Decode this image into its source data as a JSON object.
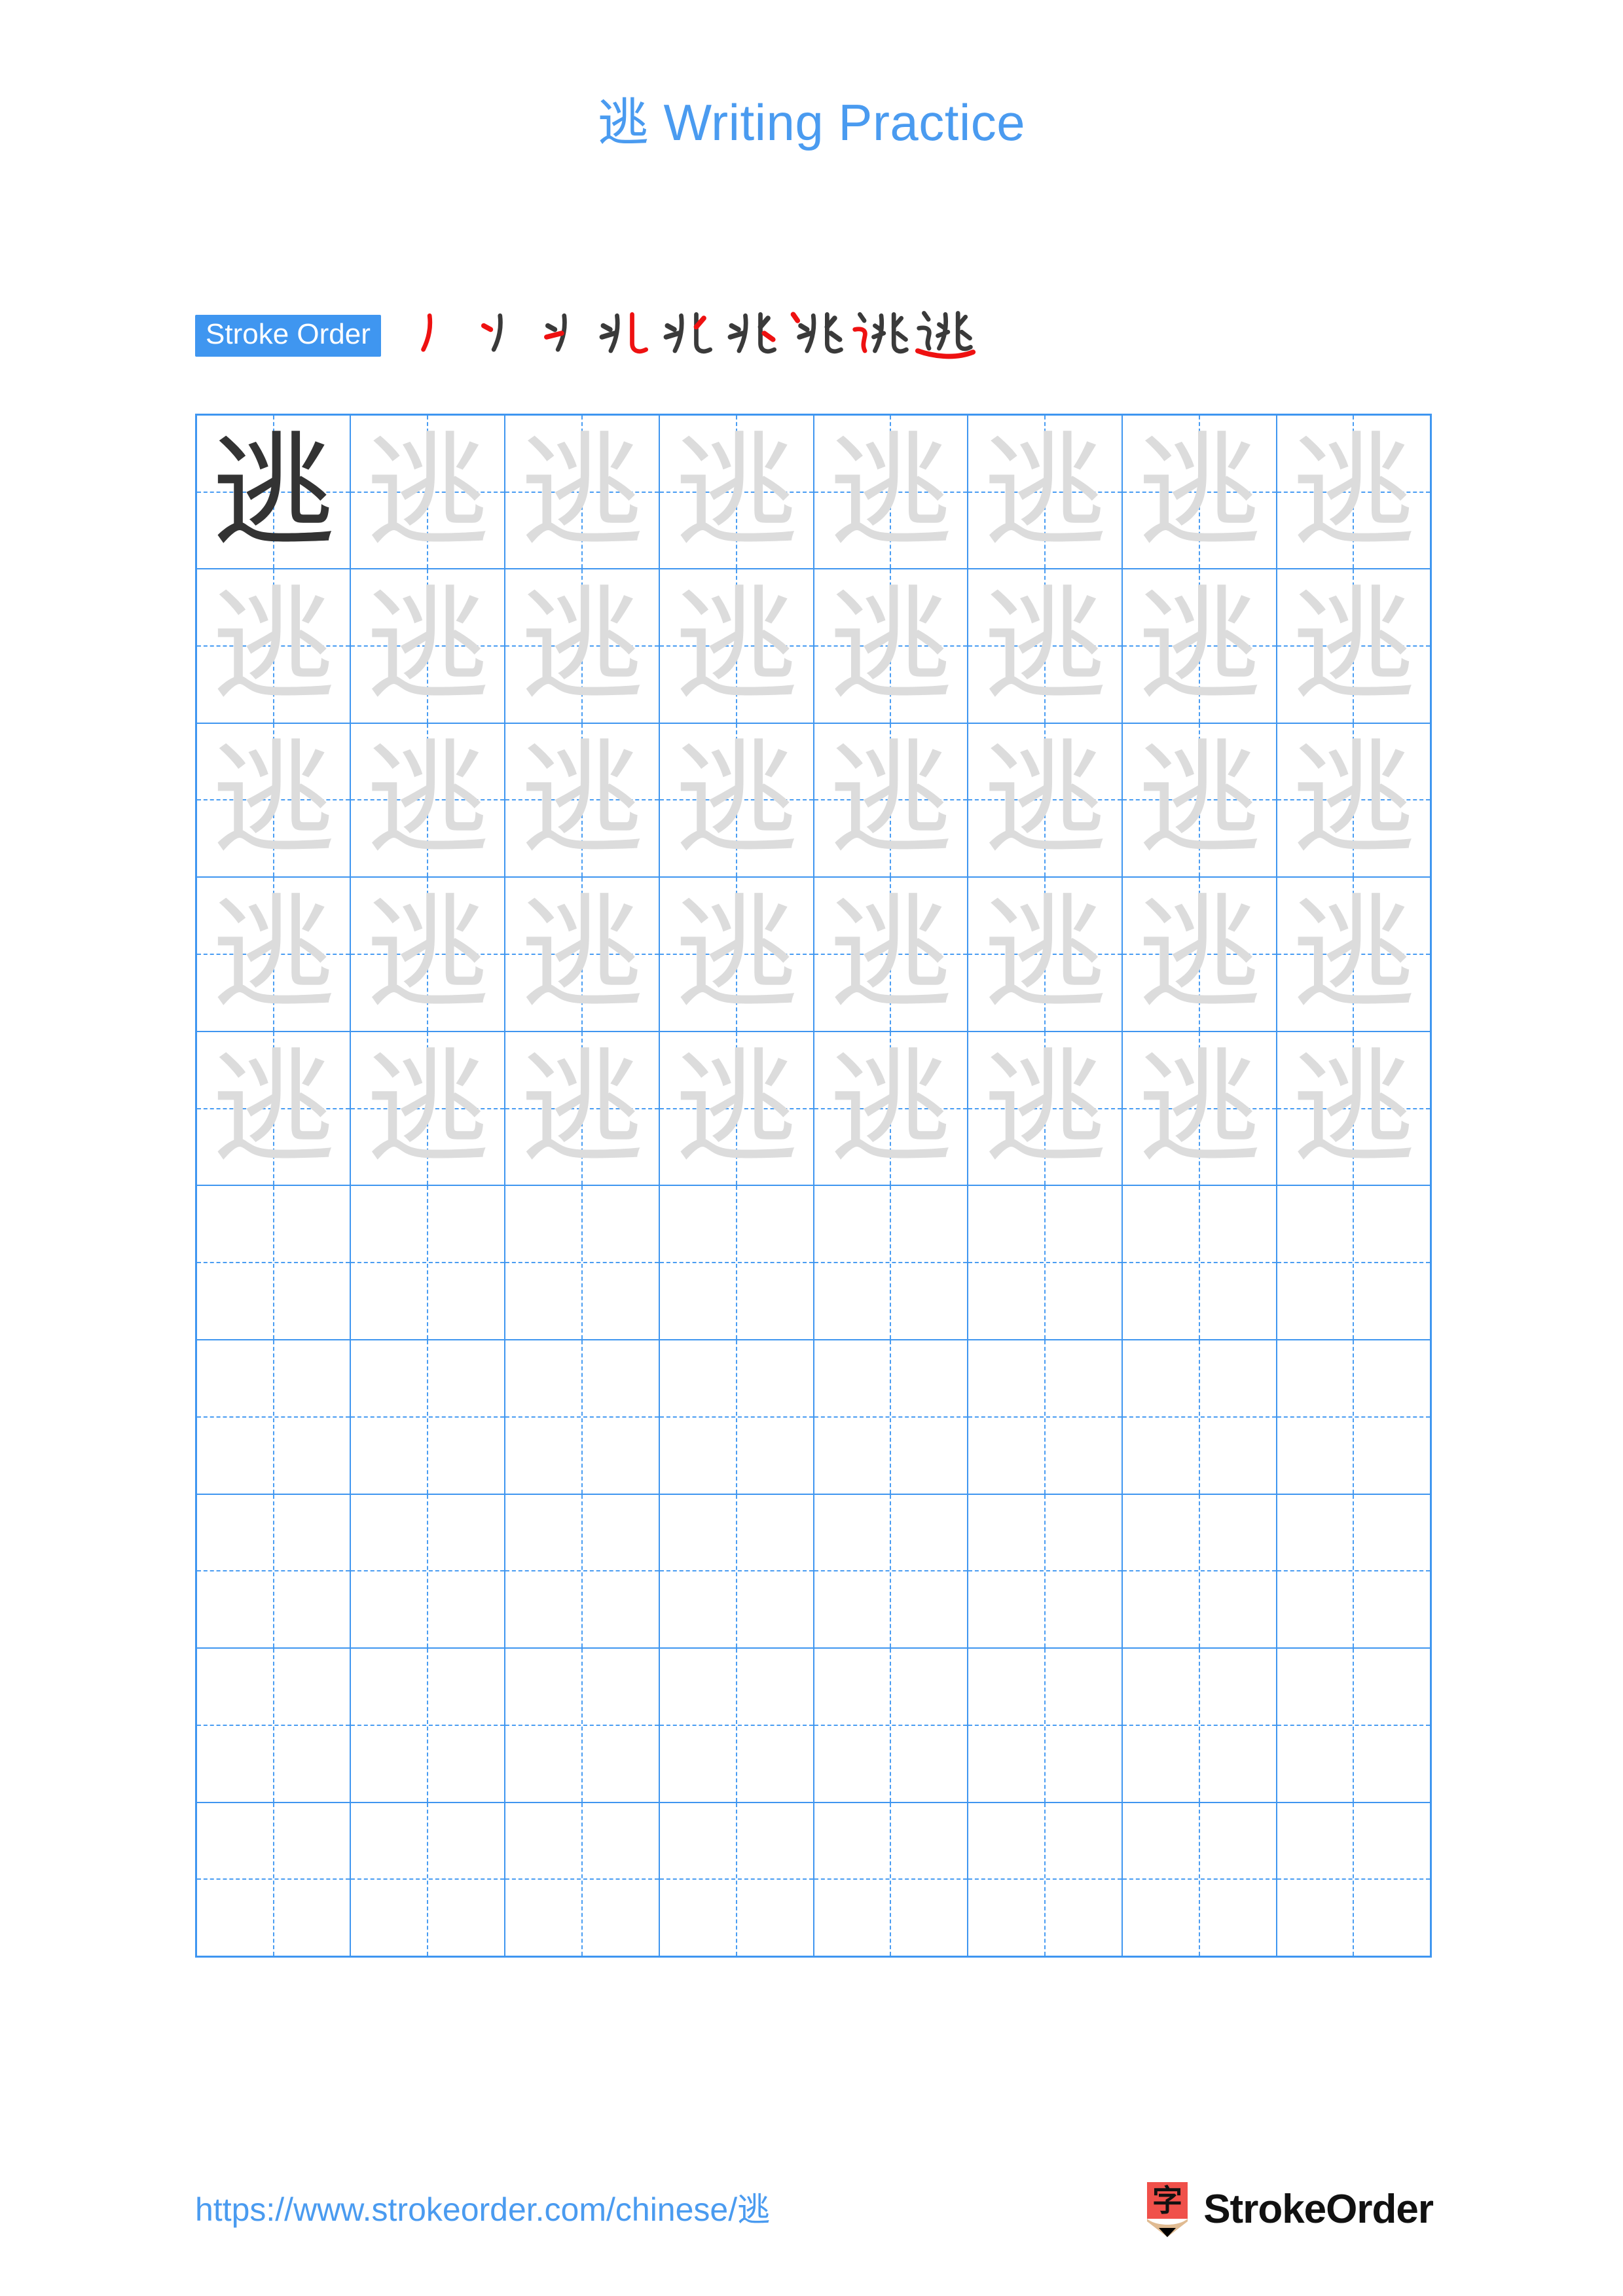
{
  "page": {
    "character": "逃",
    "title_suffix": " Writing Practice",
    "background_color": "#ffffff",
    "accent_color": "#4a9bf0"
  },
  "title": {
    "full": "逃 Writing Practice",
    "char": "逃",
    "label": "Writing Practice"
  },
  "stroke_order": {
    "badge_label": "Stroke Order",
    "badge_bg": "#3f96f0",
    "badge_text_color": "#ffffff",
    "new_stroke_color": "#ee1111",
    "old_stroke_color": "#3a3a3a",
    "total_strokes": 9,
    "steps": [
      {
        "index": 1,
        "glyph": "丿",
        "new_strokes": 1
      },
      {
        "index": 2,
        "glyph": "丿丶",
        "new_strokes": 1
      },
      {
        "index": 3,
        "glyph": "扌",
        "new_strokes": 1
      },
      {
        "index": 4,
        "glyph": "兆部分",
        "new_strokes": 1
      },
      {
        "index": 5,
        "glyph": "兆",
        "new_strokes": 1
      },
      {
        "index": 6,
        "glyph": "兆",
        "new_strokes": 1
      },
      {
        "index": 7,
        "glyph": "兆丶",
        "new_strokes": 1
      },
      {
        "index": 8,
        "glyph": "逃无捺",
        "new_strokes": 1
      },
      {
        "index": 9,
        "glyph": "逃",
        "new_strokes": 1
      }
    ]
  },
  "grid": {
    "columns": 8,
    "rows": 10,
    "border_color": "#3f96f0",
    "guide_color": "#4a9df2",
    "dark_char_color": "#333333",
    "light_char_color": "#dcdcdc",
    "cells": [
      [
        "dark",
        "light",
        "light",
        "light",
        "light",
        "light",
        "light",
        "light"
      ],
      [
        "light",
        "light",
        "light",
        "light",
        "light",
        "light",
        "light",
        "light"
      ],
      [
        "light",
        "light",
        "light",
        "light",
        "light",
        "light",
        "light",
        "light"
      ],
      [
        "light",
        "light",
        "light",
        "light",
        "light",
        "light",
        "light",
        "light"
      ],
      [
        "light",
        "light",
        "light",
        "light",
        "light",
        "light",
        "light",
        "light"
      ],
      [
        "empty",
        "empty",
        "empty",
        "empty",
        "empty",
        "empty",
        "empty",
        "empty"
      ],
      [
        "empty",
        "empty",
        "empty",
        "empty",
        "empty",
        "empty",
        "empty",
        "empty"
      ],
      [
        "empty",
        "empty",
        "empty",
        "empty",
        "empty",
        "empty",
        "empty",
        "empty"
      ],
      [
        "empty",
        "empty",
        "empty",
        "empty",
        "empty",
        "empty",
        "empty",
        "empty"
      ],
      [
        "empty",
        "empty",
        "empty",
        "empty",
        "empty",
        "empty",
        "empty",
        "empty"
      ]
    ]
  },
  "footer": {
    "url": "https://www.strokeorder.com/chinese/逃",
    "url_color": "#4a9bf0",
    "brand_name": "StrokeOrder",
    "logo_char": "字",
    "logo_body_color": "#f0504a",
    "logo_wood_color": "#e0bb92",
    "logo_tip_color": "#000000"
  }
}
